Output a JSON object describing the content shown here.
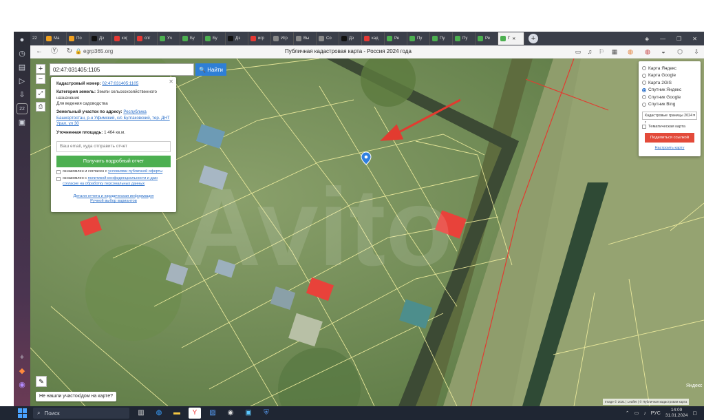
{
  "browser": {
    "tabs": [
      {
        "label": "Ма",
        "color": "#f0a020"
      },
      {
        "label": "По",
        "color": "#f0a020"
      },
      {
        "label": "Дз",
        "color": "#111111"
      },
      {
        "label": "ко(",
        "color": "#e53935"
      },
      {
        "label": "спг",
        "color": "#e53935"
      },
      {
        "label": "Уч",
        "color": "#4caf50"
      },
      {
        "label": "Бу",
        "color": "#4caf50"
      },
      {
        "label": "Бу",
        "color": "#4caf50"
      },
      {
        "label": "Дз",
        "color": "#111111"
      },
      {
        "label": "игр",
        "color": "#e53935"
      },
      {
        "label": "Игр",
        "color": "#888888"
      },
      {
        "label": "Вы",
        "color": "#888888"
      },
      {
        "label": "Со",
        "color": "#888888"
      },
      {
        "label": "Дз",
        "color": "#111111"
      },
      {
        "label": "кад",
        "color": "#e53935"
      },
      {
        "label": "Ре",
        "color": "#4caf50"
      },
      {
        "label": "Пу",
        "color": "#4caf50"
      },
      {
        "label": "Пу",
        "color": "#4caf50"
      },
      {
        "label": "Пу",
        "color": "#4caf50"
      },
      {
        "label": "Ре",
        "color": "#4caf50"
      }
    ],
    "active_tab": {
      "label": "Г",
      "color": "#4caf50"
    },
    "tab_counter": "22",
    "url": "egrp365.org",
    "page_title": "Публичная кадастровая карта - Россия 2024 года"
  },
  "search": {
    "value": "02:47:031405:1105",
    "button_label": "Найти"
  },
  "popup": {
    "cadastral_label": "Кадастровый номер:",
    "cadastral_value": "02:47:031405:1105",
    "category_label": "Категория земель:",
    "category_value": "Земли сельскохозяйственного назначения",
    "usage_value": "Для ведения садоводства",
    "address_label": "Земельный участок по адресу:",
    "address_value": "Республика Башкортостан, р-н Уфимский, с/с Булгаковский, тер. ДНТ Урал, ул 30",
    "area_label": "Уточненная площадь:",
    "area_value": "1 464 кв.м.",
    "email_placeholder": "Ваш email, куда отправить отчет",
    "report_button": "Получить подробный отчет",
    "consent_offer_prefix": "ознакомлен и согласен с ",
    "consent_offer_link": "условиями публичной оферты",
    "consent_privacy_prefix": "ознакомлен с ",
    "consent_privacy_link": "политикой конфиденциальности и даю согласие на обработку персональных данных",
    "details_link": "Детали отчета и юридическая информация",
    "manual_link": "Ручной выбор вариантов"
  },
  "layers": {
    "options": [
      {
        "label": "Карта Яндекс",
        "checked": false
      },
      {
        "label": "Карта Google",
        "checked": false
      },
      {
        "label": "Карта 2GIS",
        "checked": false
      },
      {
        "label": "Спутник Яндекс",
        "checked": true
      },
      {
        "label": "Спутник Google",
        "checked": false
      },
      {
        "label": "Спутник Bing",
        "checked": false
      }
    ],
    "select_value": "Кадастровые границы 2024 г",
    "thematic_label": "Тематическая карта",
    "share_button": "Поделиться ссылкой",
    "configure_link": "Настроить карту"
  },
  "map": {
    "watermark": "Avito",
    "not_found_tip": "Не нашли участок/дом на карте?",
    "logo": "Яндекс",
    "attribution": "Image © 2021 | Leaflet | © Публичная кадастровая карта"
  },
  "taskbar": {
    "search_label": "Поиск",
    "language": "РУС",
    "time": "14:09",
    "date": "31.01.2024"
  }
}
